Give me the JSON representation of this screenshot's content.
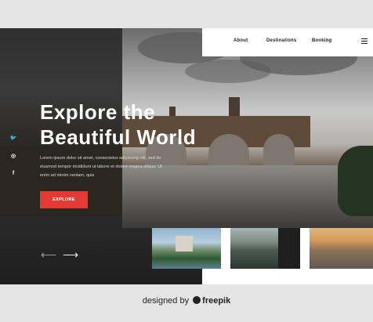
{
  "nav": {
    "items": [
      "About",
      "Destinations",
      "Booking"
    ]
  },
  "hero": {
    "title_line1": "Explore the",
    "title_line2": "Beautiful World",
    "description": "Lorem ipsum dolor sit amet, consectetur adipiscing elit, sed do eiusmod tempor incididunt ut labore et dolore magna aliqua. Ut enim ad minim veniam, quis",
    "cta_label": "EXPLORE"
  },
  "social": {
    "icons": [
      "twitter-icon",
      "instagram-icon",
      "facebook-icon"
    ],
    "glyphs": [
      "🐦",
      "◎",
      "f"
    ]
  },
  "pager": {
    "prev": "⟵",
    "next": "⟶"
  },
  "credit": {
    "prefix": "designed by",
    "brand": "freepik"
  },
  "colors": {
    "accent": "#e53935",
    "header_bg": "#ffffff"
  }
}
